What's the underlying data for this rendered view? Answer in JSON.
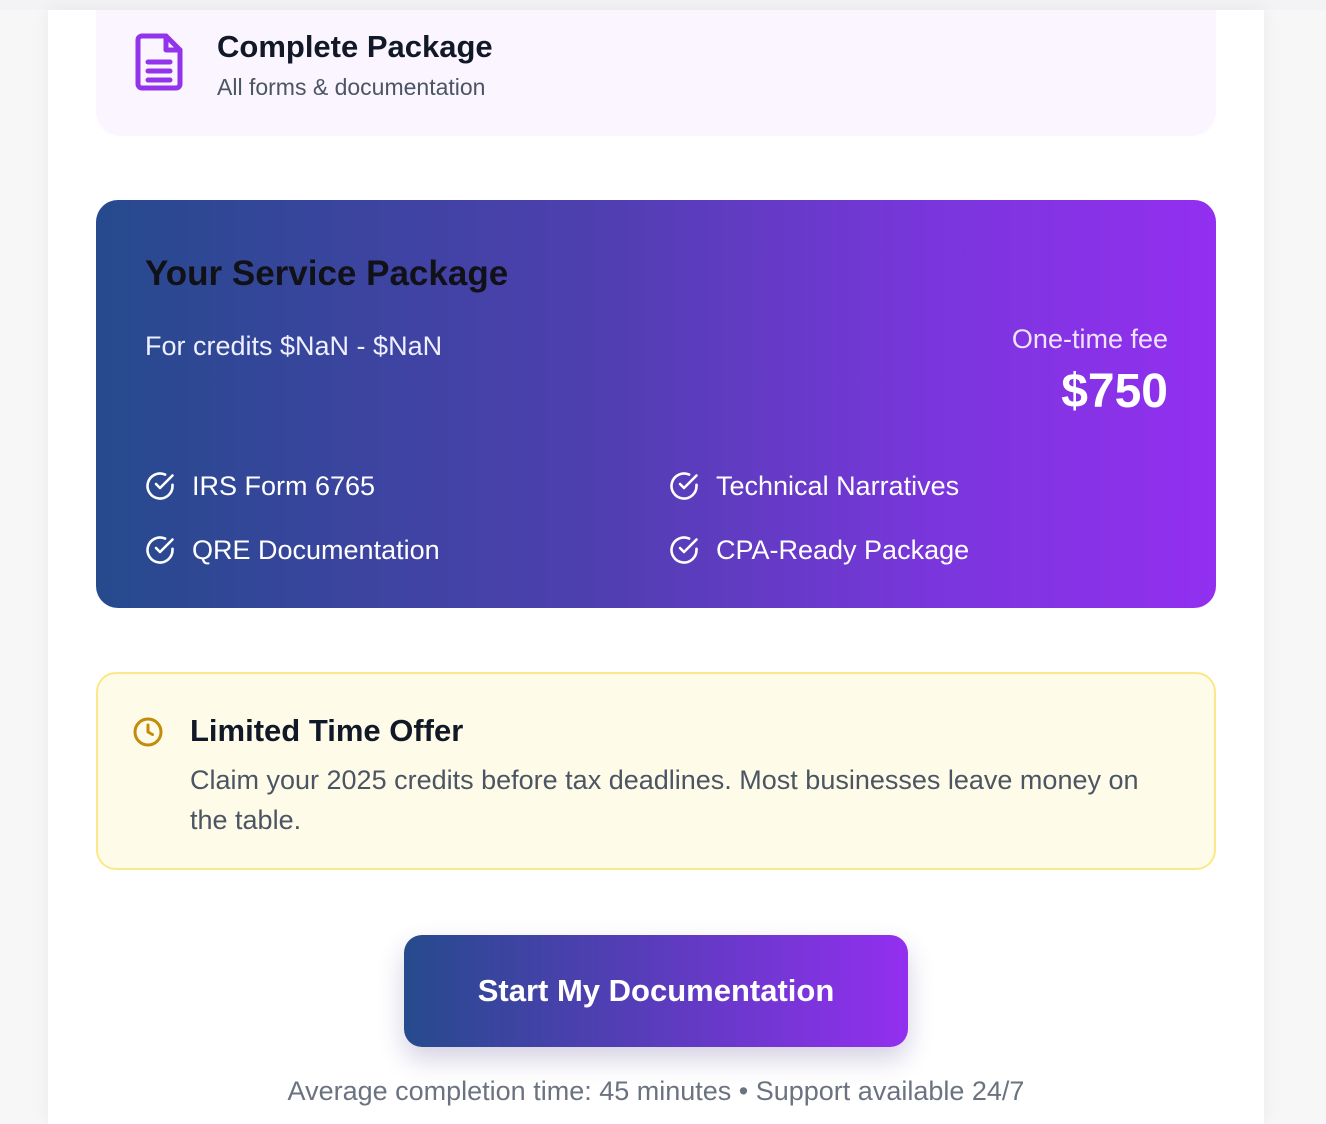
{
  "feature": {
    "icon": "document-icon",
    "title": "Complete Package",
    "subtitle": "All forms & documentation"
  },
  "service_package": {
    "title": "Your Service Package",
    "range": "For credits $NaN - $NaN",
    "fee_label": "One-time fee",
    "fee_amount": "$750",
    "items": [
      {
        "label": "IRS Form 6765",
        "icon": "check-circle-icon"
      },
      {
        "label": "Technical Narratives",
        "icon": "check-circle-icon"
      },
      {
        "label": "QRE Documentation",
        "icon": "check-circle-icon"
      },
      {
        "label": "CPA-Ready Package",
        "icon": "check-circle-icon"
      }
    ]
  },
  "offer": {
    "icon": "clock-icon",
    "title": "Limited Time Offer",
    "body": "Claim your 2025 credits before tax deadlines. Most businesses leave money on the table."
  },
  "cta": {
    "label": "Start My Documentation"
  },
  "footnote": "Average completion time: 45 minutes • Support available 24/7",
  "colors": {
    "gradient_start": "#264a8d",
    "gradient_end": "#932ff0",
    "feature_bg": "#faf5ff",
    "offer_bg": "#fefbe8",
    "offer_border": "#fbe88a",
    "offer_icon": "#c48a0c",
    "feature_icon": "#9333ea"
  }
}
